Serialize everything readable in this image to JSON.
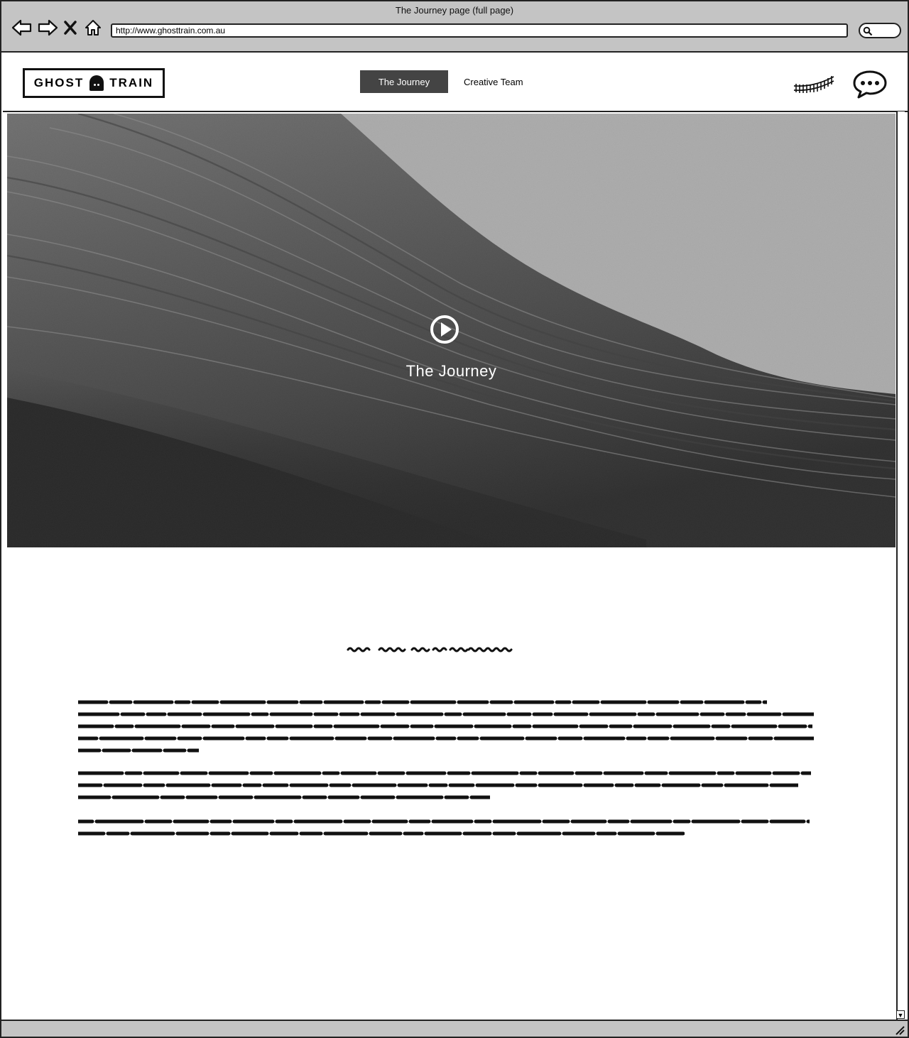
{
  "window": {
    "title": "The Journey page (full page)",
    "url": "http://www.ghosttrain.com.au"
  },
  "browser_icons": [
    "back-arrow-icon",
    "forward-arrow-icon",
    "close-icon",
    "home-icon",
    "search-icon"
  ],
  "site": {
    "logo_left": "GHOST",
    "logo_right": "TRAIN",
    "nav": [
      {
        "label": "The Journey",
        "active": true
      },
      {
        "label": "Creative Team",
        "active": false
      }
    ],
    "header_icons": [
      "train-tracks-icon",
      "chat-bubble-icon"
    ]
  },
  "hero": {
    "title": "The Journey",
    "play_icon": "play-icon"
  },
  "content": {
    "heading_placeholder": "scribbled heading text",
    "paragraphs": [
      {
        "lines": 5
      },
      {
        "lines": 3
      },
      {
        "lines": 2
      }
    ]
  },
  "colors": {
    "chrome": "#c4c4c4",
    "nav_active": "#444444",
    "hero_dark": "#000000",
    "hero_light": "#bdbdbd"
  }
}
